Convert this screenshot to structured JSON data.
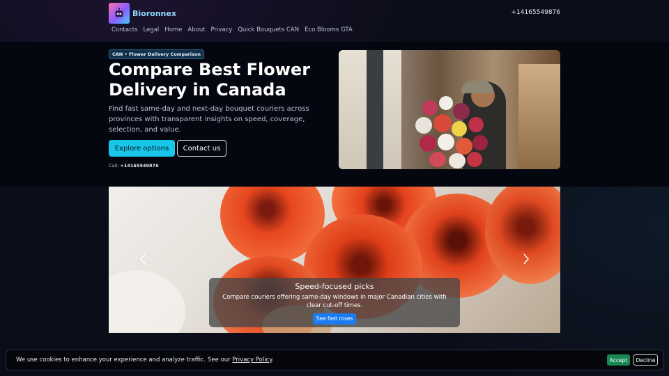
{
  "brand": {
    "name": "Bioronnex",
    "logo_icon": "robot-icon"
  },
  "header": {
    "phone": "+14165549876"
  },
  "nav": {
    "items": [
      "Contacts",
      "Legal",
      "Home",
      "About",
      "Privacy",
      "Quick Bouquets CAN",
      "Eco Blooms GTA"
    ]
  },
  "hero": {
    "badge": "CAN • Flower Delivery Comparison",
    "title": "Compare Best Flower Delivery in Canada",
    "description": "Find fast same-day and next-day bouquet couriers across provinces with transparent insights on speed, coverage, selection, and value.",
    "primary_button": "Explore options",
    "secondary_button": "Contact us",
    "call_label": "Call:",
    "call_number": "+14165549876"
  },
  "carousel": {
    "caption_title": "Speed-focused picks",
    "caption_text": "Compare couriers offering same-day windows in major Canadian cities with clear cut-off times.",
    "caption_button": "See fast roses",
    "prev_icon": "chevron-left-icon",
    "next_icon": "chevron-right-icon"
  },
  "cookie": {
    "text": "We use cookies to enhance your experience and analyze traffic. See our",
    "link": "Privacy Policy",
    "suffix": ".",
    "accept": "Accept",
    "decline": "Decline"
  },
  "colors": {
    "accent": "#17c6e8",
    "accept": "#198754",
    "caption_button": "#1a7cf0",
    "brand_text": "#8fd8ff"
  }
}
